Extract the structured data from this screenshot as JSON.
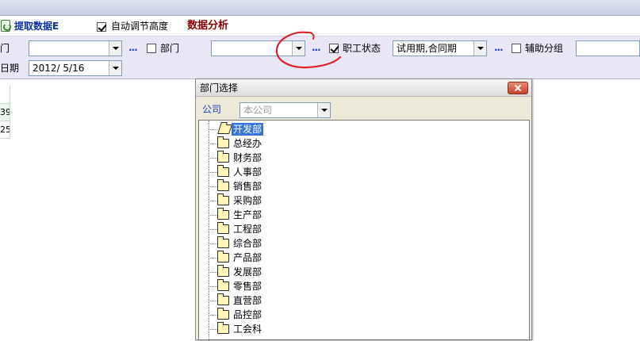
{
  "toolbar": {
    "fetch_label": "提取数据E",
    "auto_height_label": "自动调节高度",
    "auto_height_checked": true,
    "analysis_label": "数据分析"
  },
  "filters": {
    "row1_left_label": "门",
    "dept_label": "部门",
    "dept_checked": false,
    "status_label": "职工状态",
    "status_checked": true,
    "status_value": "试用期,合同期",
    "aux_group_label": "辅助分组",
    "aux_group_checked": false,
    "more_label": "...",
    "row2_left_label": "日期",
    "date_value": "2012/  5/16"
  },
  "grid": {
    "cells": [
      "39",
      "25"
    ]
  },
  "dialog": {
    "title": "部门选择",
    "company_label": "公司",
    "company_value": "本公司",
    "departments": [
      {
        "label": "开发部",
        "selected": true,
        "open": true
      },
      {
        "label": "总经办"
      },
      {
        "label": "财务部"
      },
      {
        "label": "人事部"
      },
      {
        "label": "销售部"
      },
      {
        "label": "采购部"
      },
      {
        "label": "生产部"
      },
      {
        "label": "工程部"
      },
      {
        "label": "综合部"
      },
      {
        "label": "产品部"
      },
      {
        "label": "发展部"
      },
      {
        "label": "零售部"
      },
      {
        "label": "直营部"
      },
      {
        "label": "品控部"
      },
      {
        "label": "工会科"
      }
    ]
  },
  "colors": {
    "filter_panel_bg": "#e9e6f6",
    "selection": "#3875d7",
    "annotation": "#e0202a"
  },
  "icons": [
    "refresh-icon",
    "checkbox-icon",
    "dropdown-arrow-icon",
    "close-icon",
    "folder-icon",
    "folder-open-icon"
  ]
}
